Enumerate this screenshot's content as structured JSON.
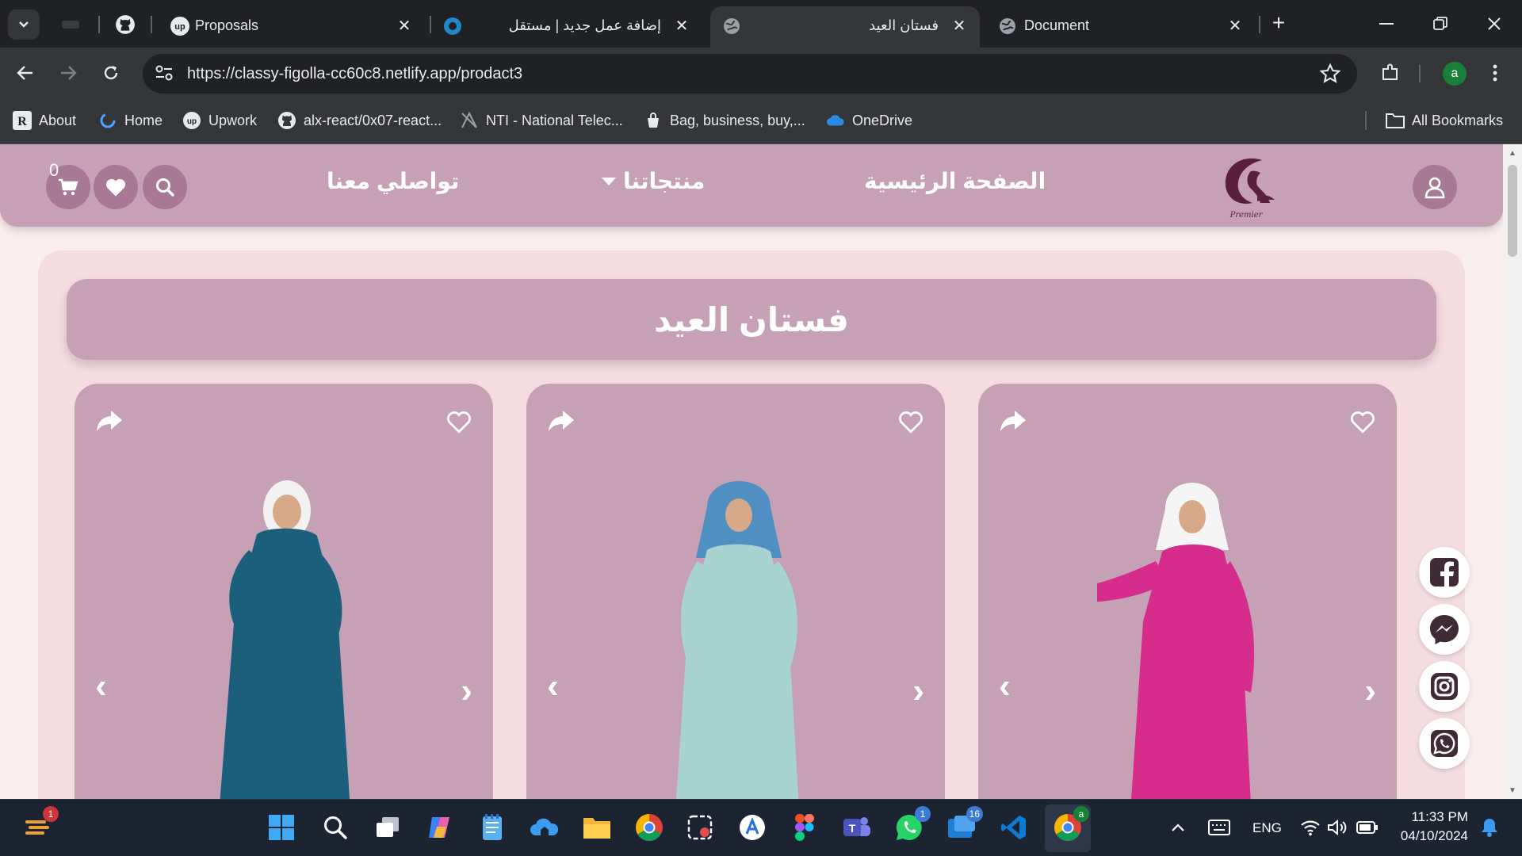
{
  "browser": {
    "tabs": [
      {
        "title": "Proposals",
        "favicon": "upwork-icon"
      },
      {
        "title": "إضافة عمل جديد | مستقل",
        "favicon": "mostaql-icon"
      },
      {
        "title": "فستان العيد",
        "favicon": "globe-icon",
        "active": true
      },
      {
        "title": "Document",
        "favicon": "globe-icon"
      }
    ],
    "url": "https://classy-figolla-cc60c8.netlify.app/prodact3",
    "profile_initial": "a",
    "bookmarks": [
      {
        "label": "About",
        "icon": "r-icon"
      },
      {
        "label": "Home",
        "icon": "loader-icon"
      },
      {
        "label": "Upwork",
        "icon": "upwork-icon"
      },
      {
        "label": "alx-react/0x07-react...",
        "icon": "github-icon"
      },
      {
        "label": "NTI - National Telec...",
        "icon": "nti-icon"
      },
      {
        "label": "Bag, business, buy,...",
        "icon": "bag-icon"
      },
      {
        "label": "OneDrive",
        "icon": "onedrive-icon"
      }
    ],
    "all_bookmarks": "All Bookmarks"
  },
  "site": {
    "cart_count": "0",
    "nav": {
      "contact": "تواصلي معنا",
      "products": "منتجاتنا",
      "home": "الصفحة الرئيسية"
    },
    "logo_text": "Premier",
    "page_title": "فستان العيد",
    "products": [
      {
        "dress_color": "#1c5f7c",
        "hijab_color": "#f2f2f2"
      },
      {
        "dress_color": "#a8d3d0",
        "hijab_color": "#4f8fc2"
      },
      {
        "dress_color": "#d62c8c",
        "hijab_color": "#f5f5f5"
      }
    ],
    "social": [
      "facebook-icon",
      "messenger-icon",
      "instagram-icon",
      "whatsapp-icon"
    ]
  },
  "taskbar": {
    "language": "ENG",
    "time": "11:33 PM",
    "date": "04/10/2024",
    "badges": {
      "weather": "1",
      "whatsapp": "1",
      "teams": "16"
    }
  },
  "colors": {
    "nav_bg": "#c6a0b5",
    "page_bg": "#fbeeee",
    "container_bg": "#f4dce1",
    "button_bg": "#a77994"
  }
}
